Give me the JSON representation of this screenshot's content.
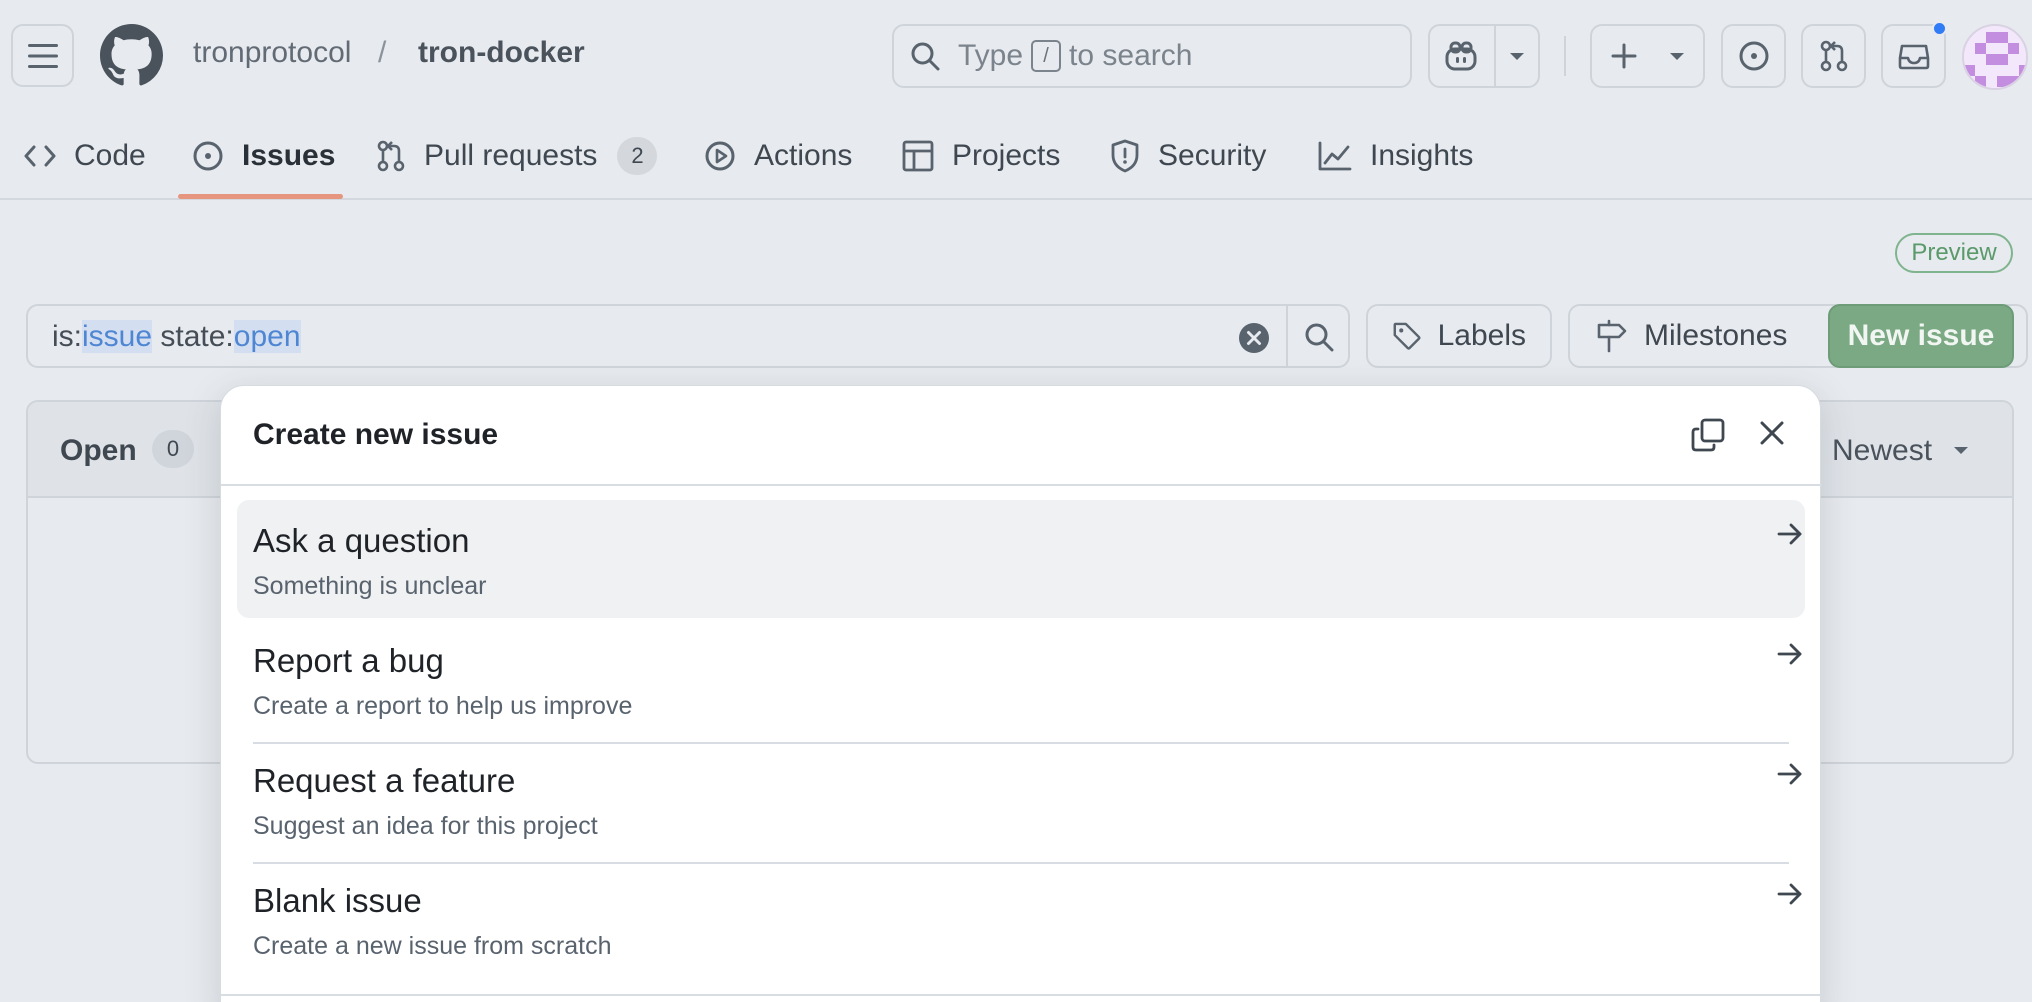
{
  "header": {
    "owner": "tronprotocol",
    "separator": "/",
    "repo": "tron-docker",
    "search": {
      "prefix": "Type",
      "key": "/",
      "suffix": "to search"
    },
    "icons": [
      "hamburger-icon",
      "github-logo-icon",
      "search-icon",
      "copilot-icon",
      "chevron-down-icon",
      "plus-icon",
      "issue-opened-icon",
      "pull-request-icon",
      "inbox-icon"
    ],
    "notification_dot_color": "#2f7cf6"
  },
  "repo_nav": {
    "tabs": [
      {
        "label": "Code",
        "icon": "code-icon"
      },
      {
        "label": "Issues",
        "icon": "issue-opened-icon",
        "selected": true
      },
      {
        "label": "Pull requests",
        "icon": "pull-request-icon",
        "count": "2"
      },
      {
        "label": "Actions",
        "icon": "play-icon"
      },
      {
        "label": "Projects",
        "icon": "table-icon"
      },
      {
        "label": "Security",
        "icon": "shield-icon"
      },
      {
        "label": "Insights",
        "icon": "graph-icon"
      }
    ],
    "selected_underline_color": "#e6967e"
  },
  "toolbar": {
    "preview_badge": "Preview",
    "filter": {
      "t1": "is:",
      "t2": "issue",
      "t3": " state:",
      "t4": "open"
    },
    "labels_button": "Labels",
    "milestones_button": "Milestones",
    "new_issue_button": "New issue",
    "accent_green": "#7aa984"
  },
  "issue_list": {
    "open_label": "Open",
    "open_count": "0",
    "sort_label": "Newest"
  },
  "dialog": {
    "title": "Create new issue",
    "templates": [
      {
        "title": "Ask a question",
        "description": "Something is unclear"
      },
      {
        "title": "Report a bug",
        "description": "Create a report to help us improve"
      },
      {
        "title": "Request a feature",
        "description": "Suggest an idea for this project"
      },
      {
        "title": "Blank issue",
        "description": "Create a new issue from scratch"
      }
    ]
  }
}
